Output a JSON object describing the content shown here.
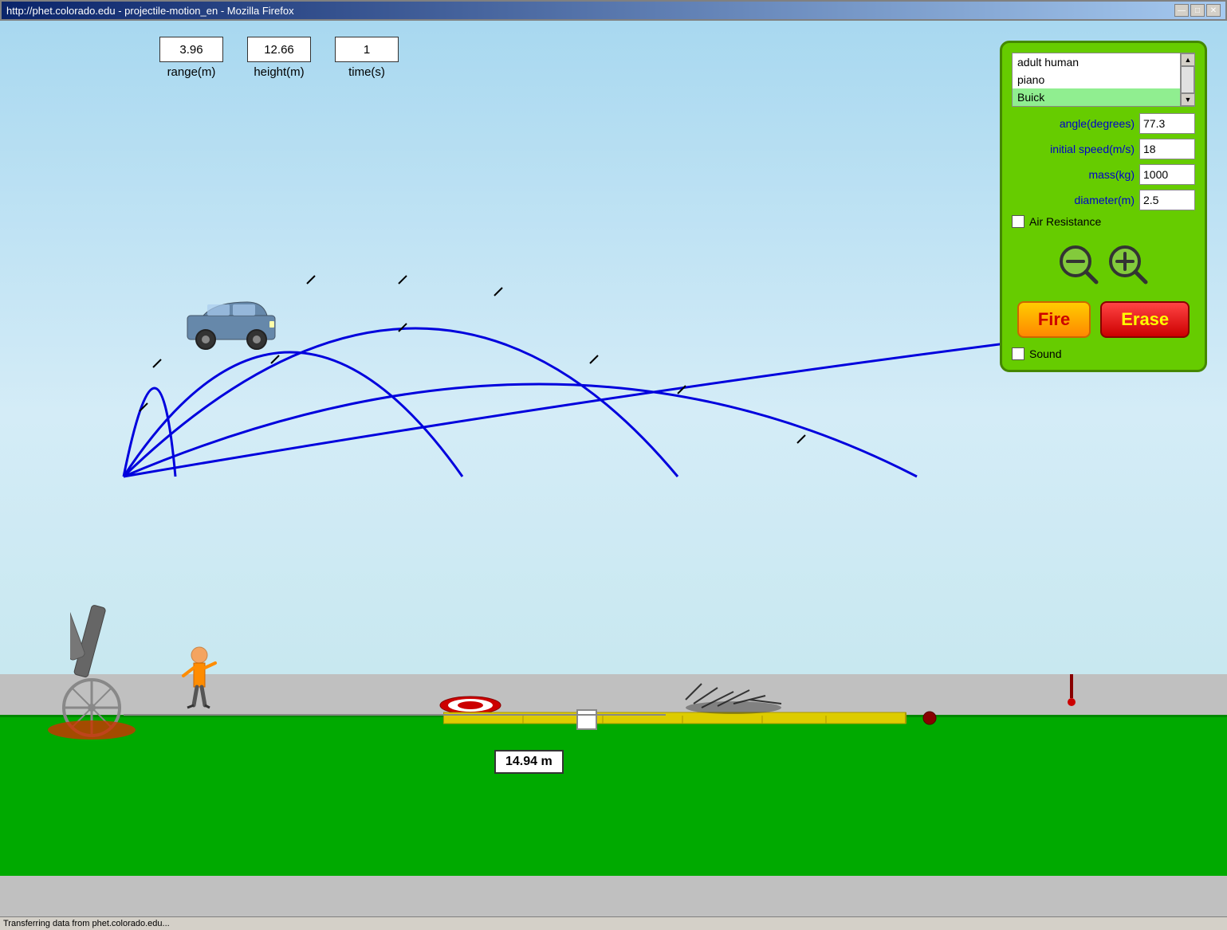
{
  "browser": {
    "title": "http://phet.colorado.edu - projectile-motion_en - Mozilla Firefox",
    "address": "http://phet.colorado.edu",
    "status": "Transferring data from phet.colorado.edu..."
  },
  "stats": {
    "range": {
      "value": "3.96",
      "label": "range(m)"
    },
    "height": {
      "value": "12.66",
      "label": "height(m)"
    },
    "time": {
      "value": "1",
      "label": "time(s)"
    }
  },
  "control_panel": {
    "objects": [
      "adult human",
      "piano",
      "Buick"
    ],
    "selected_object": "Buick",
    "angle_label": "angle(degrees)",
    "angle_value": "77.3",
    "speed_label": "initial speed(m/s)",
    "speed_value": "18",
    "mass_label": "mass(kg)",
    "mass_value": "1000",
    "diameter_label": "diameter(m)",
    "diameter_value": "2.5",
    "air_resistance_label": "Air Resistance",
    "air_resistance_checked": false,
    "zoom_out_label": "−",
    "zoom_in_label": "+",
    "fire_label": "Fire",
    "erase_label": "Erase",
    "sound_label": "Sound",
    "sound_checked": false
  },
  "measurement": {
    "value": "14.94 m"
  },
  "icons": {
    "minimize": "—",
    "maximize": "□",
    "close": "✕",
    "scroll_up": "▲",
    "scroll_down": "▼"
  }
}
